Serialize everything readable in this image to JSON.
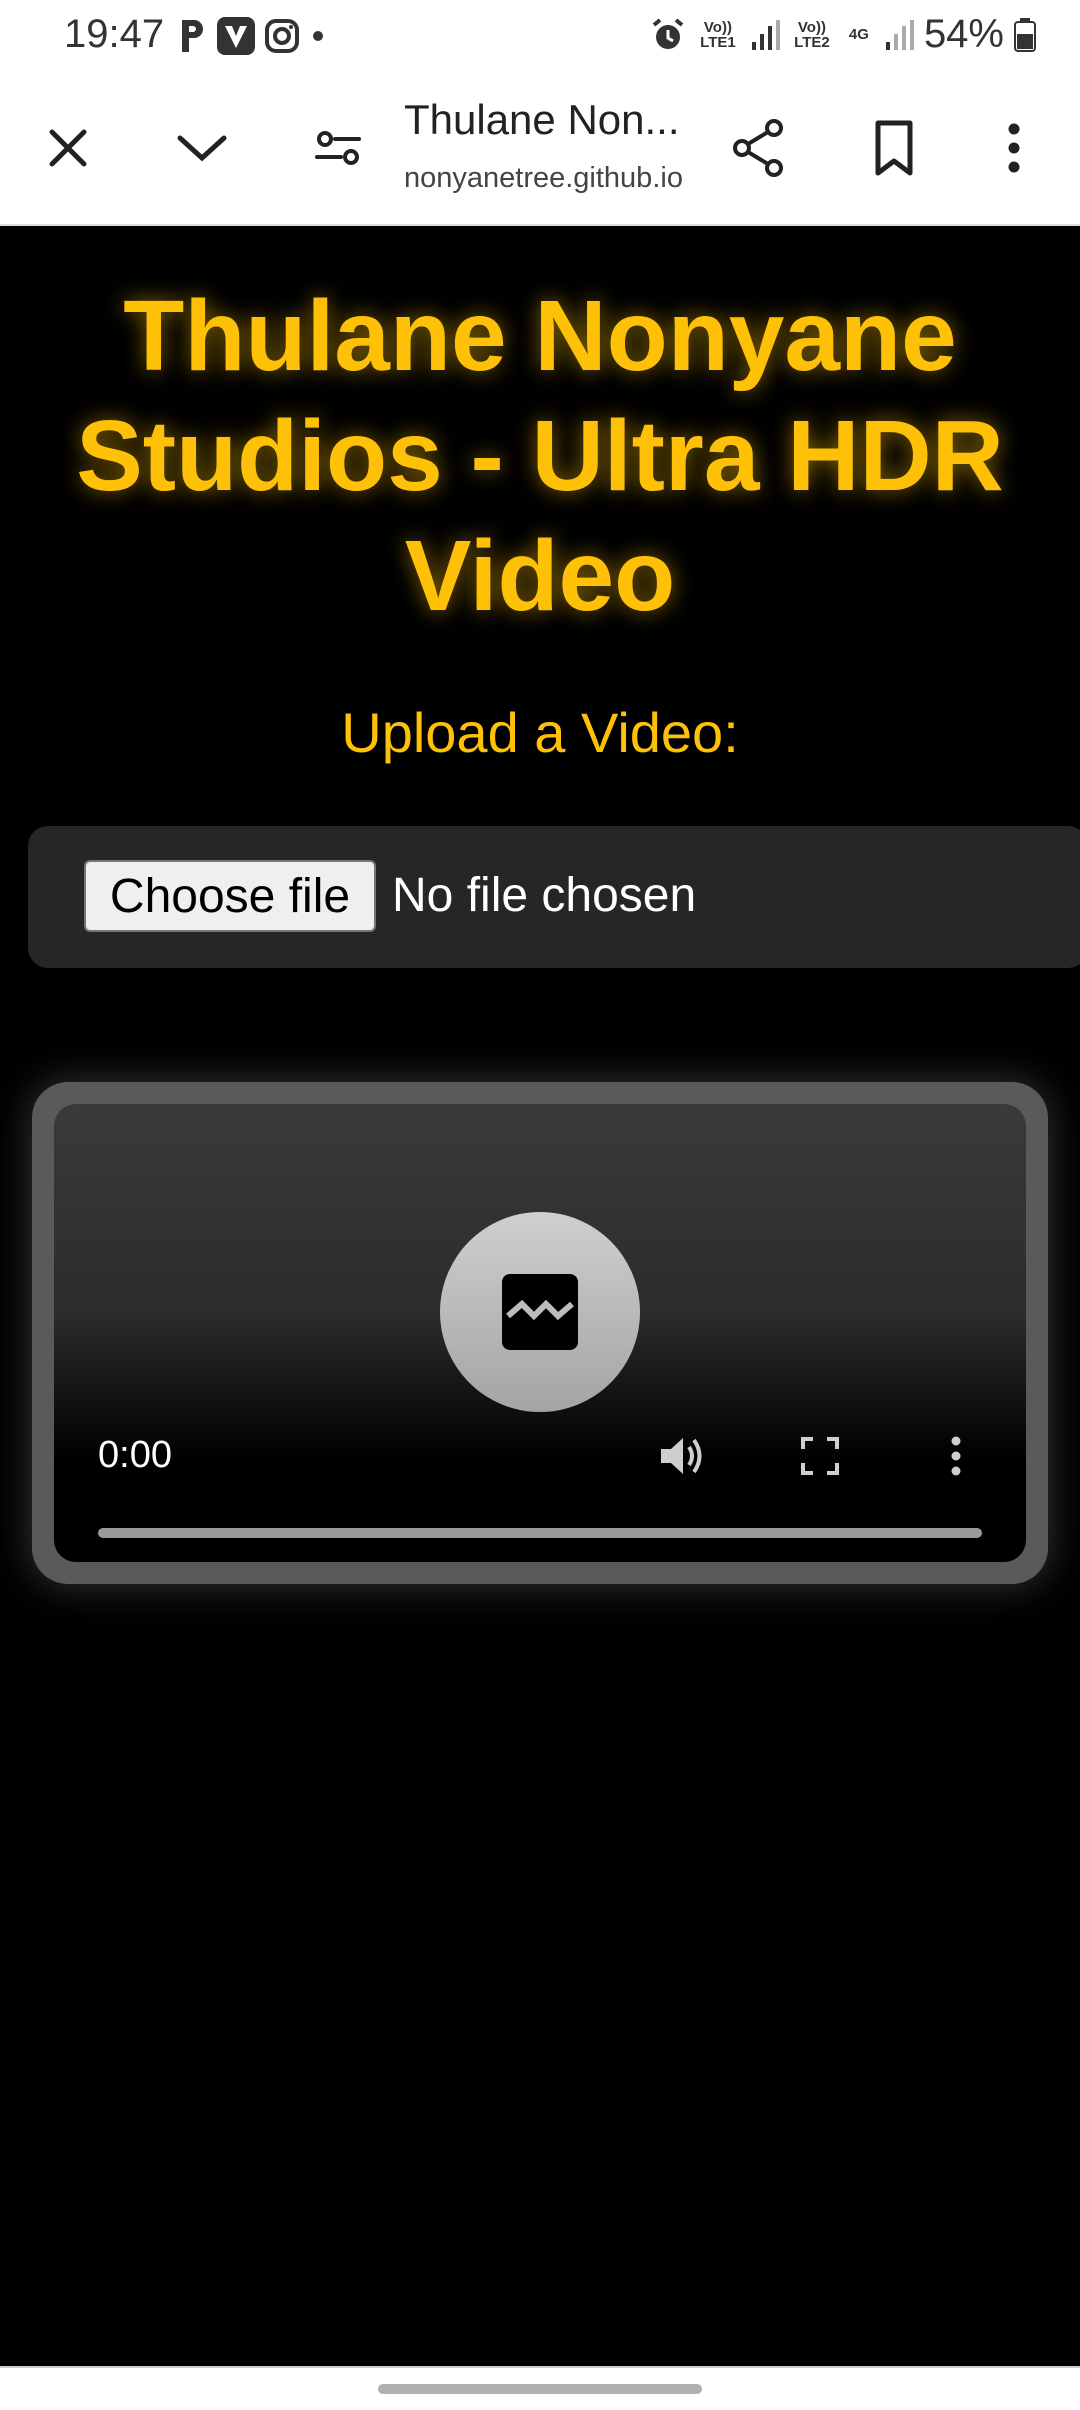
{
  "status_bar": {
    "time": "19:47",
    "battery": "54%",
    "network_1": "Vo)) LTE1",
    "network_2": "Vo)) LTE2",
    "network_type": "4G",
    "app_icons": [
      "p-app-icon",
      "v-app-icon",
      "instagram-icon"
    ]
  },
  "browser": {
    "title": "Thulane Non...",
    "url": "nonyanetree.github.io"
  },
  "page": {
    "heading": "Thulane Nonyane Studios - Ultra HDR Video",
    "upload_label": "Upload a Video:",
    "file_input": {
      "button_label": "Choose file",
      "status": "No file chosen"
    },
    "video": {
      "time": "0:00",
      "progress": 0
    }
  },
  "colors": {
    "accent": "#ffc107",
    "background": "#000000"
  }
}
